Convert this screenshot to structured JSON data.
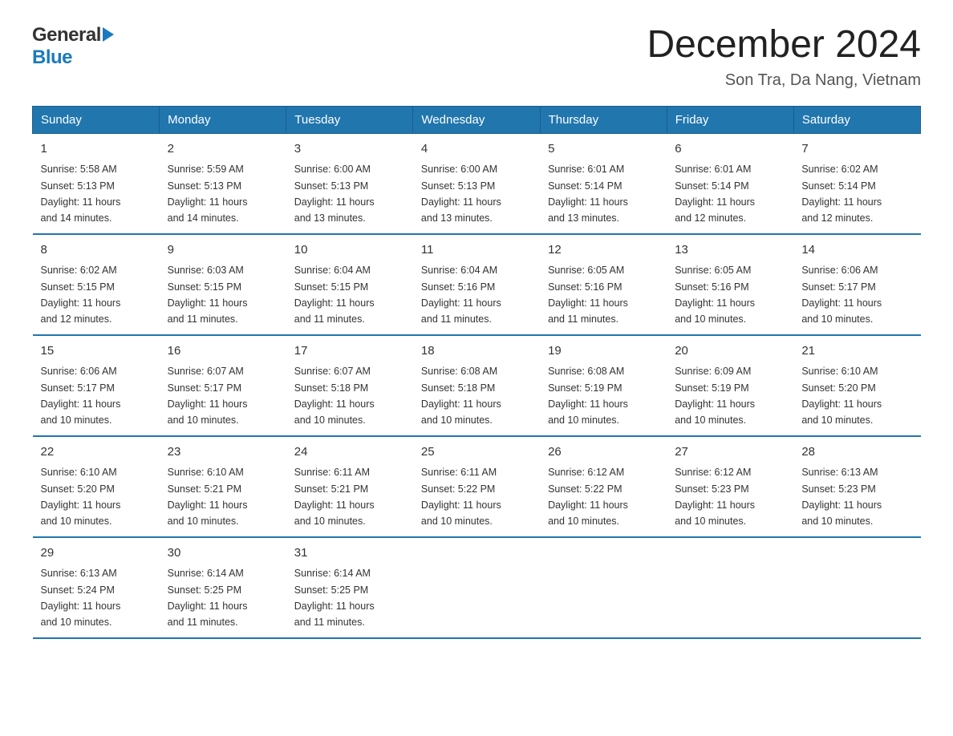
{
  "logo": {
    "line1": "General",
    "line2": "Blue"
  },
  "title": "December 2024",
  "subtitle": "Son Tra, Da Nang, Vietnam",
  "days_header": [
    "Sunday",
    "Monday",
    "Tuesday",
    "Wednesday",
    "Thursday",
    "Friday",
    "Saturday"
  ],
  "weeks": [
    [
      {
        "day": "1",
        "sunrise": "5:58 AM",
        "sunset": "5:13 PM",
        "daylight": "11 hours and 14 minutes."
      },
      {
        "day": "2",
        "sunrise": "5:59 AM",
        "sunset": "5:13 PM",
        "daylight": "11 hours and 14 minutes."
      },
      {
        "day": "3",
        "sunrise": "6:00 AM",
        "sunset": "5:13 PM",
        "daylight": "11 hours and 13 minutes."
      },
      {
        "day": "4",
        "sunrise": "6:00 AM",
        "sunset": "5:13 PM",
        "daylight": "11 hours and 13 minutes."
      },
      {
        "day": "5",
        "sunrise": "6:01 AM",
        "sunset": "5:14 PM",
        "daylight": "11 hours and 13 minutes."
      },
      {
        "day": "6",
        "sunrise": "6:01 AM",
        "sunset": "5:14 PM",
        "daylight": "11 hours and 12 minutes."
      },
      {
        "day": "7",
        "sunrise": "6:02 AM",
        "sunset": "5:14 PM",
        "daylight": "11 hours and 12 minutes."
      }
    ],
    [
      {
        "day": "8",
        "sunrise": "6:02 AM",
        "sunset": "5:15 PM",
        "daylight": "11 hours and 12 minutes."
      },
      {
        "day": "9",
        "sunrise": "6:03 AM",
        "sunset": "5:15 PM",
        "daylight": "11 hours and 11 minutes."
      },
      {
        "day": "10",
        "sunrise": "6:04 AM",
        "sunset": "5:15 PM",
        "daylight": "11 hours and 11 minutes."
      },
      {
        "day": "11",
        "sunrise": "6:04 AM",
        "sunset": "5:16 PM",
        "daylight": "11 hours and 11 minutes."
      },
      {
        "day": "12",
        "sunrise": "6:05 AM",
        "sunset": "5:16 PM",
        "daylight": "11 hours and 11 minutes."
      },
      {
        "day": "13",
        "sunrise": "6:05 AM",
        "sunset": "5:16 PM",
        "daylight": "11 hours and 10 minutes."
      },
      {
        "day": "14",
        "sunrise": "6:06 AM",
        "sunset": "5:17 PM",
        "daylight": "11 hours and 10 minutes."
      }
    ],
    [
      {
        "day": "15",
        "sunrise": "6:06 AM",
        "sunset": "5:17 PM",
        "daylight": "11 hours and 10 minutes."
      },
      {
        "day": "16",
        "sunrise": "6:07 AM",
        "sunset": "5:17 PM",
        "daylight": "11 hours and 10 minutes."
      },
      {
        "day": "17",
        "sunrise": "6:07 AM",
        "sunset": "5:18 PM",
        "daylight": "11 hours and 10 minutes."
      },
      {
        "day": "18",
        "sunrise": "6:08 AM",
        "sunset": "5:18 PM",
        "daylight": "11 hours and 10 minutes."
      },
      {
        "day": "19",
        "sunrise": "6:08 AM",
        "sunset": "5:19 PM",
        "daylight": "11 hours and 10 minutes."
      },
      {
        "day": "20",
        "sunrise": "6:09 AM",
        "sunset": "5:19 PM",
        "daylight": "11 hours and 10 minutes."
      },
      {
        "day": "21",
        "sunrise": "6:10 AM",
        "sunset": "5:20 PM",
        "daylight": "11 hours and 10 minutes."
      }
    ],
    [
      {
        "day": "22",
        "sunrise": "6:10 AM",
        "sunset": "5:20 PM",
        "daylight": "11 hours and 10 minutes."
      },
      {
        "day": "23",
        "sunrise": "6:10 AM",
        "sunset": "5:21 PM",
        "daylight": "11 hours and 10 minutes."
      },
      {
        "day": "24",
        "sunrise": "6:11 AM",
        "sunset": "5:21 PM",
        "daylight": "11 hours and 10 minutes."
      },
      {
        "day": "25",
        "sunrise": "6:11 AM",
        "sunset": "5:22 PM",
        "daylight": "11 hours and 10 minutes."
      },
      {
        "day": "26",
        "sunrise": "6:12 AM",
        "sunset": "5:22 PM",
        "daylight": "11 hours and 10 minutes."
      },
      {
        "day": "27",
        "sunrise": "6:12 AM",
        "sunset": "5:23 PM",
        "daylight": "11 hours and 10 minutes."
      },
      {
        "day": "28",
        "sunrise": "6:13 AM",
        "sunset": "5:23 PM",
        "daylight": "11 hours and 10 minutes."
      }
    ],
    [
      {
        "day": "29",
        "sunrise": "6:13 AM",
        "sunset": "5:24 PM",
        "daylight": "11 hours and 10 minutes."
      },
      {
        "day": "30",
        "sunrise": "6:14 AM",
        "sunset": "5:25 PM",
        "daylight": "11 hours and 11 minutes."
      },
      {
        "day": "31",
        "sunrise": "6:14 AM",
        "sunset": "5:25 PM",
        "daylight": "11 hours and 11 minutes."
      },
      null,
      null,
      null,
      null
    ]
  ],
  "labels": {
    "sunrise": "Sunrise:",
    "sunset": "Sunset:",
    "daylight": "Daylight:"
  }
}
